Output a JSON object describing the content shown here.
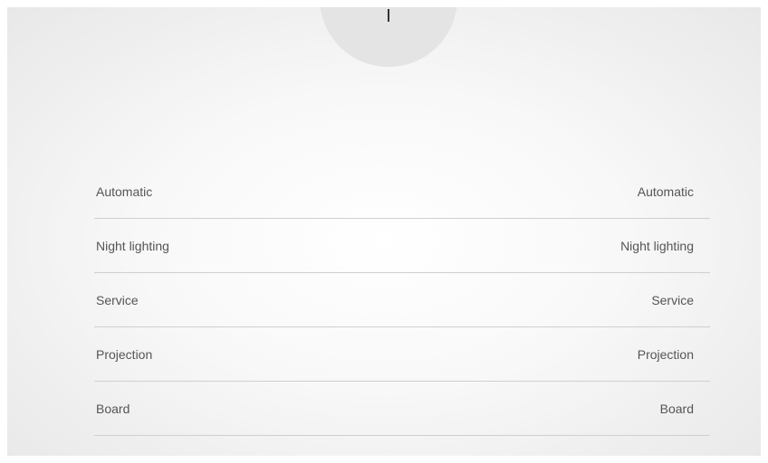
{
  "dial": {
    "icon": "dial-indicator"
  },
  "modes": [
    {
      "label": "Automatic",
      "value": "Automatic"
    },
    {
      "label": "Night lighting",
      "value": "Night lighting"
    },
    {
      "label": "Service",
      "value": "Service"
    },
    {
      "label": "Projection",
      "value": "Projection"
    },
    {
      "label": "Board",
      "value": "Board"
    }
  ]
}
